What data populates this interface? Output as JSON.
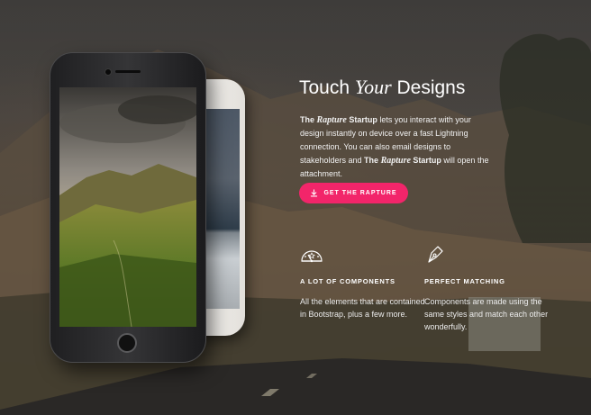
{
  "hero": {
    "title_pre": "Touch ",
    "title_em": "Your",
    "title_post": " Designs",
    "desc": {
      "p1": "The ",
      "p2": "Rapture",
      "p3": " Startup",
      "p4": " lets you interact with your design instantly on device over a fast Lightning connection. You can also email designs to stakeholders and ",
      "p5": "The ",
      "p6": "Rapture",
      "p7": " Startup",
      "p8": " will open the attachment."
    },
    "cta_label": "GET THE RAPTURE",
    "accent_color": "#f2256a"
  },
  "features": [
    {
      "icon": "dashboard-icon",
      "title": "A LOT OF COMPONENTS",
      "text": "All the elements that are contained in Bootstrap, plus a few more."
    },
    {
      "icon": "pen-nib-icon",
      "title": "PERFECT MATCHING",
      "text": "Components are made using the same styles and match each other wonderfully."
    }
  ]
}
